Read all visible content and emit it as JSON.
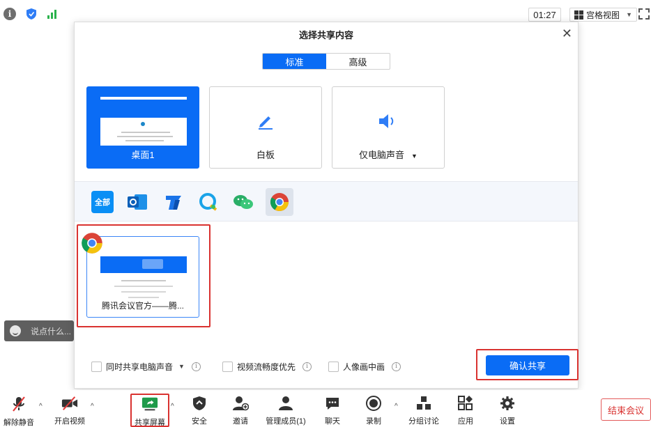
{
  "topbar": {
    "timer": "01:27",
    "view_label": "宫格视图"
  },
  "chat": {
    "placeholder": "说点什么..."
  },
  "dialog": {
    "title": "选择共享内容",
    "tabs": [
      {
        "label": "标准",
        "active": true
      },
      {
        "label": "高级",
        "active": false
      }
    ],
    "options": [
      {
        "label": "桌面1",
        "selected": true
      },
      {
        "label": "白板",
        "selected": false
      },
      {
        "label": "仅电脑声音",
        "selected": false
      }
    ],
    "apps": {
      "all_label": "全部",
      "icons": [
        "outlook-icon",
        "tencent-docs-icon",
        "qq-browser-icon",
        "wechat-icon",
        "chrome-icon"
      ]
    },
    "windows": [
      {
        "label": "腾讯会议官方——腾...",
        "app": "chrome-icon"
      }
    ],
    "checkboxes": [
      {
        "label": "同时共享电脑声音",
        "checked": false
      },
      {
        "label": "视频流畅度优先",
        "checked": false
      },
      {
        "label": "人像画中画",
        "checked": false
      }
    ],
    "confirm_label": "确认共享"
  },
  "toolbar": {
    "items": [
      {
        "label": "解除静音"
      },
      {
        "label": "开启视频"
      },
      {
        "label": "共享屏幕"
      },
      {
        "label": "安全"
      },
      {
        "label": "邀请"
      },
      {
        "label": "管理成员(1)"
      },
      {
        "label": "聊天"
      },
      {
        "label": "录制"
      },
      {
        "label": "分组讨论"
      },
      {
        "label": "应用"
      },
      {
        "label": "设置"
      }
    ],
    "end_label": "结束会议"
  },
  "colors": {
    "accent": "#0a6cf5",
    "highlight": "#d93230"
  }
}
